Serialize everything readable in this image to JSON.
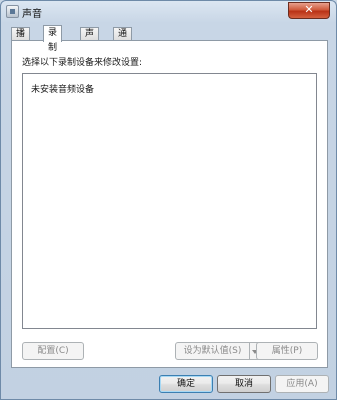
{
  "window": {
    "title": "声音",
    "close_label": "✕"
  },
  "tabs": [
    {
      "label": "播放"
    },
    {
      "label": "录制"
    },
    {
      "label": "声音"
    },
    {
      "label": "通信"
    }
  ],
  "panel": {
    "instruction": "选择以下录制设备来修改设置:",
    "empty_message": "未安装音频设备",
    "configure_label": "配置(C)",
    "set_default_label": "设为默认值(S)",
    "properties_label": "属性(P)"
  },
  "footer": {
    "ok_label": "确定",
    "cancel_label": "取消",
    "apply_label": "应用(A)"
  }
}
